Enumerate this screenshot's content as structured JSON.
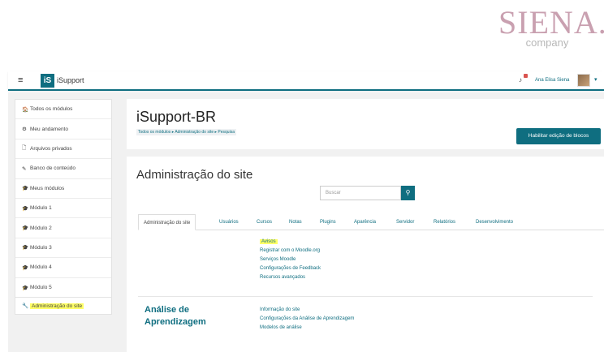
{
  "brand": {
    "name": "SIENA.",
    "sub": "company"
  },
  "navbar": {
    "menu_icon": "≡",
    "logo": "iS",
    "app_name": "iSupport",
    "notifications": "bell-icon",
    "user_name": "Ana Elisa Siena",
    "caret": "▾"
  },
  "sidebar": {
    "items": [
      {
        "icon": "home-icon",
        "glyph": "🏠",
        "label": "Todos os módulos"
      },
      {
        "icon": "dashboard-icon",
        "glyph": "⚙",
        "label": "Meu andamento"
      },
      {
        "icon": "file-icon",
        "glyph": "🗋",
        "label": "Arquivos privados"
      },
      {
        "icon": "pencil-icon",
        "glyph": "✎",
        "label": "Banco de conteúdo"
      },
      {
        "icon": "graduation-icon",
        "glyph": "🎓",
        "label": "Meus módulos"
      },
      {
        "icon": "graduation-icon",
        "glyph": "🎓",
        "label": "Módulo 1"
      },
      {
        "icon": "graduation-icon",
        "glyph": "🎓",
        "label": "Módulo 2"
      },
      {
        "icon": "graduation-icon",
        "glyph": "🎓",
        "label": "Módulo 3"
      },
      {
        "icon": "graduation-icon",
        "glyph": "🎓",
        "label": "Módulo 4"
      },
      {
        "icon": "graduation-icon",
        "glyph": "🎓",
        "label": "Módulo 5"
      }
    ],
    "admin": {
      "icon": "wrench-icon",
      "glyph": "🔧",
      "label": "Administração do site"
    }
  },
  "header": {
    "title": "iSupport-BR",
    "breadcrumb": "Todos os módulos  ▸  Administração do site  ▸  Pesquisa",
    "edit_button": "Habilitar edição de blocos"
  },
  "main": {
    "title": "Administração do site",
    "search_placeholder": "Buscar",
    "tabs": [
      "Administração do site",
      "Usuários",
      "Cursos",
      "Notas",
      "Plugins",
      "Aparência",
      "Servidor",
      "Relatórios",
      "Desenvolvimento"
    ],
    "general_links": [
      "Avisos",
      "Registrar com o Moodle.org",
      "Serviços Moodle",
      "Configurações de Feedback",
      "Recursos avançados"
    ],
    "analytics": {
      "title": "Análise de Aprendizagem",
      "links": [
        "Informação do site",
        "Configurações da Análise de Aprendizagem",
        "Modelos de análise"
      ]
    }
  },
  "colors": {
    "accent": "#0f6e80",
    "highlight": "#ffff66",
    "brand": "#c9a0b0"
  }
}
